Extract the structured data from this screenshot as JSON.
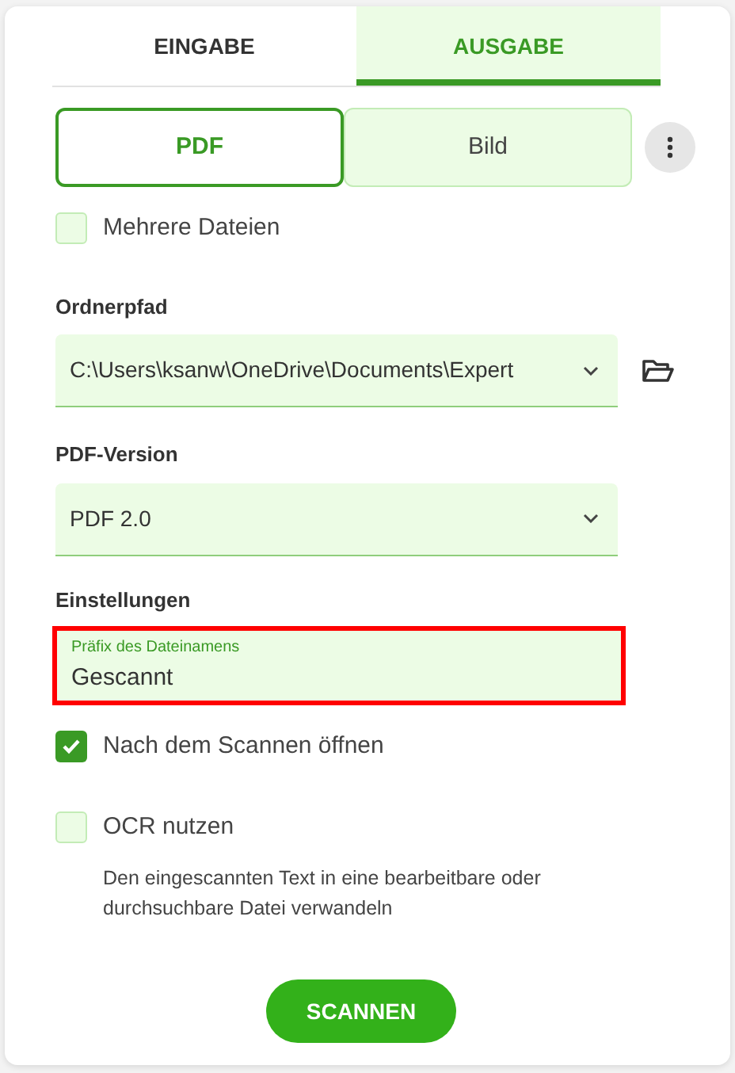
{
  "tabs": [
    {
      "label": "EINGABE",
      "selected": false
    },
    {
      "label": "AUSGABE",
      "selected": true
    }
  ],
  "format_toggle": [
    {
      "label": "PDF",
      "selected": true
    },
    {
      "label": "Bild",
      "selected": false
    }
  ],
  "multiple_files": {
    "label": "Mehrere Dateien",
    "checked": false
  },
  "folder_path": {
    "label": "Ordnerpfad",
    "value": "C:\\Users\\ksanw\\OneDrive\\Documents\\Expert"
  },
  "pdf_version": {
    "label": "PDF-Version",
    "value": "PDF 2.0"
  },
  "settings": {
    "heading": "Einstellungen",
    "prefix_field": {
      "label": "Präfix des Dateinamens",
      "value": "Gescannt",
      "highlighted": true
    },
    "options": [
      {
        "label": "Nach dem Scannen öffnen",
        "checked": true
      },
      {
        "label": "OCR nutzen",
        "checked": false,
        "description": "Den eingescannten Text in eine bearbeitbare oder durchsuchbare Datei verwandeln"
      }
    ]
  },
  "scan_button": "SCANNEN"
}
